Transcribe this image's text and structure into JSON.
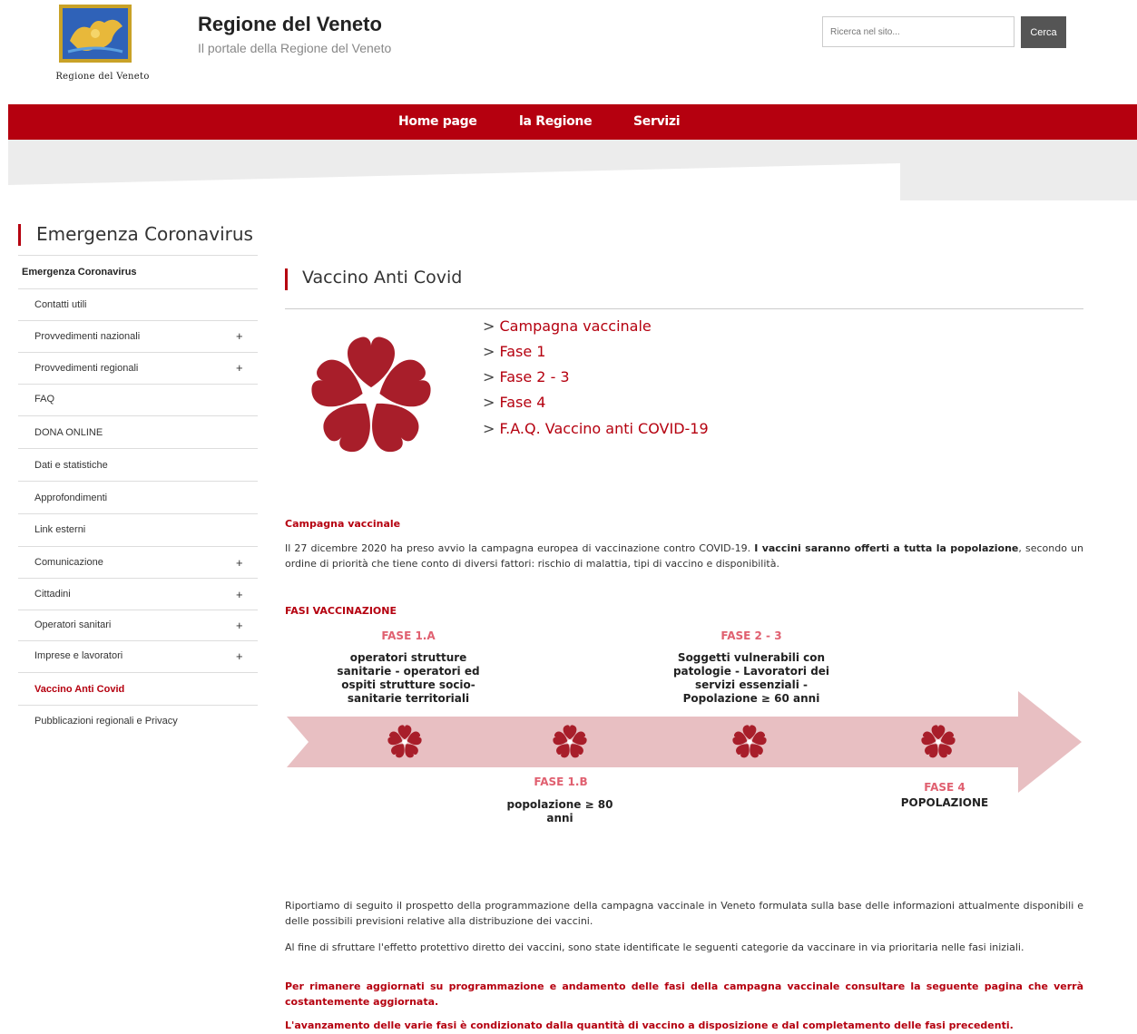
{
  "header": {
    "logo_text": "Regione del Veneto",
    "site_title": "Regione del Veneto",
    "site_subtitle": "Il portale della Regione del Veneto",
    "search_placeholder": "Ricerca nel sito...",
    "search_button": "Cerca"
  },
  "nav": {
    "items": [
      "Home page",
      "la Regione",
      "Servizi"
    ]
  },
  "sidebar": {
    "title": "Emergenza Coronavirus",
    "items": [
      {
        "label": "Emergenza Coronavirus",
        "expandable": false,
        "active": true
      },
      {
        "label": "Contatti utili",
        "expandable": false
      },
      {
        "label": "Provvedimenti nazionali",
        "expandable": true
      },
      {
        "label": "Provvedimenti regionali",
        "expandable": true
      },
      {
        "label": "FAQ",
        "expandable": false
      },
      {
        "label": "DONA ONLINE",
        "expandable": false
      },
      {
        "label": "Dati e statistiche",
        "expandable": false
      },
      {
        "label": "Approfondimenti",
        "expandable": false
      },
      {
        "label": "Link esterni",
        "expandable": false
      },
      {
        "label": "Comunicazione",
        "expandable": true
      },
      {
        "label": "Cittadini",
        "expandable": true
      },
      {
        "label": "Operatori sanitari",
        "expandable": true
      },
      {
        "label": "Imprese e lavoratori",
        "expandable": true
      },
      {
        "label": "Vaccino Anti Covid",
        "expandable": false,
        "current": true
      },
      {
        "label": "Pubblicazioni regionali e Privacy",
        "expandable": false
      }
    ],
    "plus_symbol": "+"
  },
  "main": {
    "title": "Vaccino Anti Covid",
    "link_prefix": ">",
    "links": [
      "Campagna vaccinale",
      "Fase 1",
      "Fase 2 - 3",
      "Fase 4",
      "F.A.Q. Vaccino anti COVID-19"
    ],
    "campagna_heading": "Campagna vaccinale",
    "campagna_text_1": "Il 27 dicembre 2020 ha preso avvio la campagna europea di vaccinazione contro COVID-19. ",
    "campagna_text_bold": "I vaccini saranno offerti a tutta la popolazione",
    "campagna_text_2": ", secondo un ordine di priorità che tiene conto di diversi fattori: rischio di malattia, tipi di vaccino e disponibilità.",
    "fasi_heading": "FASI VACCINAZIONE",
    "fasi": [
      {
        "label": "FASE 1.A",
        "desc": "operatori strutture sanitarie - operatori ed ospiti strutture socio-sanitarie territoriali"
      },
      {
        "label": "FASE 1.B",
        "desc": "popolazione ≥ 80 anni"
      },
      {
        "label": "FASE 2 - 3",
        "desc": "Soggetti vulnerabili con patologie - Lavoratori dei servizi essenziali - Popolazione ≥ 60 anni"
      },
      {
        "label": "FASE 4",
        "desc": "POPOLAZIONE"
      }
    ],
    "para_1": "Riportiamo di seguito il prospetto della programmazione della campagna vaccinale in Veneto formulata sulla base delle informazioni attualmente disponibili e delle possibili previsioni relative alla distribuzione dei vaccini.",
    "para_2": "Al fine di sfruttare l'effetto protettivo diretto dei vaccini, sono state identificate le seguenti categorie da vaccinare in via prioritaria nelle fasi iniziali.",
    "para_3": "Per rimanere aggiornati su programmazione e andamento delle fasi della campagna vaccinale consultare la seguente pagina che verrà costantemente aggiornata.",
    "para_4": "L'avanzamento delle varie fasi è condizionato dalla quantità di vaccino a disposizione e dal completamento delle fasi precedenti."
  },
  "colors": {
    "brand_red": "#b5000f",
    "flower_red": "#a81e2a",
    "arrow_pink": "#e8bfc2"
  }
}
